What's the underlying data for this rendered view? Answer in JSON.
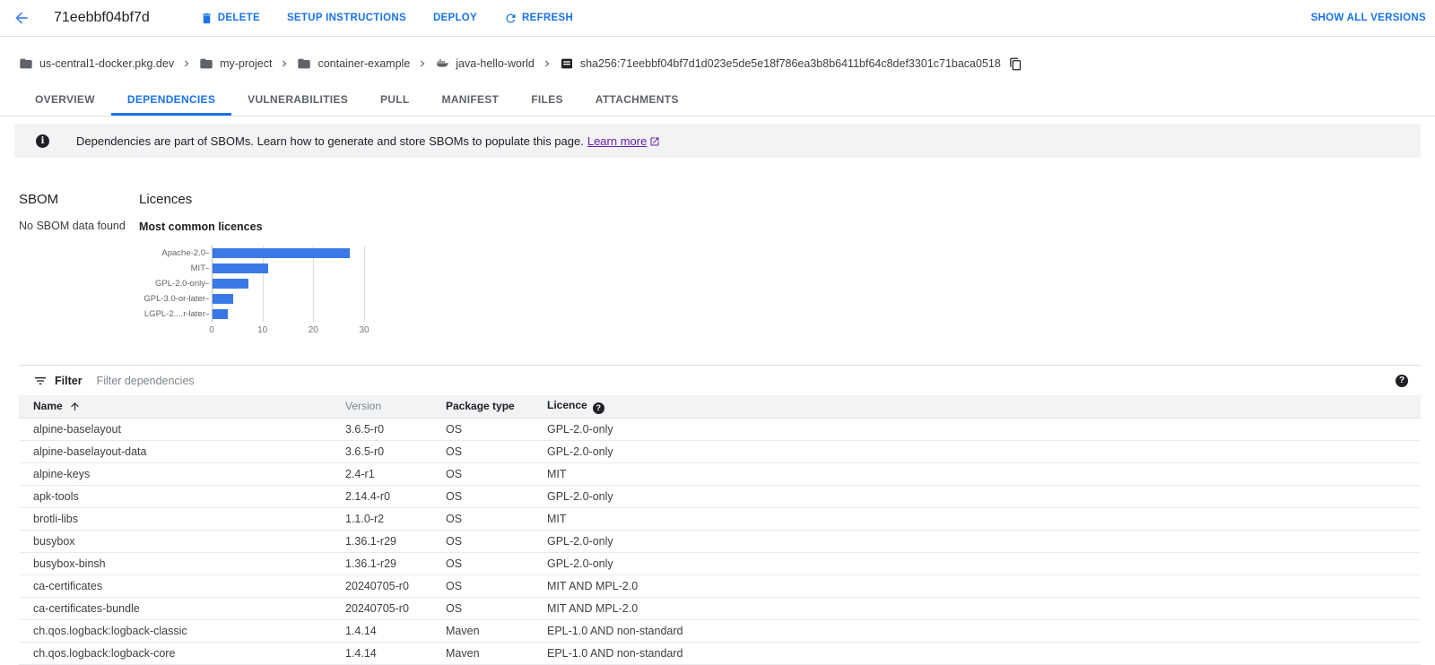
{
  "colors": {
    "accent_blue": "#1a73e8",
    "bar_blue": "#3b78e7",
    "link_purple": "#681da8",
    "banner_bg": "#f1f3f4",
    "header_row_bg": "#f1f3f4",
    "border": "#e0e0e0"
  },
  "topbar": {
    "back_icon": "arrow-back-icon",
    "title": "71eebbf04bf7d",
    "actions": [
      {
        "label": "DELETE",
        "icon": "trash"
      },
      {
        "label": "SETUP INSTRUCTIONS",
        "icon": null
      },
      {
        "label": "DEPLOY",
        "icon": null
      },
      {
        "label": "REFRESH",
        "icon": "refresh"
      }
    ],
    "show_all_versions_label": "SHOW ALL VERSIONS"
  },
  "breadcrumb": {
    "items": [
      {
        "label": "us-central1-docker.pkg.dev",
        "icon": "folder"
      },
      {
        "label": "my-project",
        "icon": "folder"
      },
      {
        "label": "container-example",
        "icon": "folder"
      },
      {
        "label": "java-hello-world",
        "icon": "docker"
      },
      {
        "label": "sha256:71eebbf04bf7d1d023e5de5e18f786ea3b8b6411bf64c8def3301c71baca0518",
        "icon": "image"
      }
    ],
    "copy_icon": "copy-icon"
  },
  "tabs": {
    "items": [
      "OVERVIEW",
      "DEPENDENCIES",
      "VULNERABILITIES",
      "PULL",
      "MANIFEST",
      "FILES",
      "ATTACHMENTS"
    ],
    "active": "DEPENDENCIES"
  },
  "banner": {
    "icon": "info-icon",
    "text": "Dependencies are part of SBOMs. Learn how to generate and store SBOMs to populate this page.",
    "link_label": "Learn more",
    "link_icon": "external-link-icon"
  },
  "sbom": {
    "title": "SBOM",
    "empty_text": "No SBOM data found"
  },
  "licences": {
    "title": "Licences"
  },
  "chart_data": {
    "type": "bar",
    "orientation": "horizontal",
    "title": "Most common licences",
    "categories": [
      "Apache-2.0",
      "MIT",
      "GPL-2.0-only",
      "GPL-3.0-or-later",
      "LGPL-2....r-later"
    ],
    "values": [
      27,
      11,
      7,
      4,
      3
    ],
    "xlim": [
      0,
      30
    ],
    "xticks": [
      0,
      10,
      20,
      30
    ],
    "bar_color": "#3b78e7",
    "grid": true,
    "legend": "none"
  },
  "filter": {
    "icon": "filter-list-icon",
    "label": "Filter",
    "placeholder": "Filter dependencies",
    "help_icon": "help-icon"
  },
  "table": {
    "columns": [
      "Name",
      "Version",
      "Package type",
      "Licence"
    ],
    "sort": {
      "column": "Name",
      "direction": "asc"
    },
    "licence_help_icon": "help-icon",
    "rows": [
      {
        "name": "alpine-baselayout",
        "version": "3.6.5-r0",
        "package_type": "OS",
        "licence": "GPL-2.0-only"
      },
      {
        "name": "alpine-baselayout-data",
        "version": "3.6.5-r0",
        "package_type": "OS",
        "licence": "GPL-2.0-only"
      },
      {
        "name": "alpine-keys",
        "version": "2.4-r1",
        "package_type": "OS",
        "licence": "MIT"
      },
      {
        "name": "apk-tools",
        "version": "2.14.4-r0",
        "package_type": "OS",
        "licence": "GPL-2.0-only"
      },
      {
        "name": "brotli-libs",
        "version": "1.1.0-r2",
        "package_type": "OS",
        "licence": "MIT"
      },
      {
        "name": "busybox",
        "version": "1.36.1-r29",
        "package_type": "OS",
        "licence": "GPL-2.0-only"
      },
      {
        "name": "busybox-binsh",
        "version": "1.36.1-r29",
        "package_type": "OS",
        "licence": "GPL-2.0-only"
      },
      {
        "name": "ca-certificates",
        "version": "20240705-r0",
        "package_type": "OS",
        "licence": "MIT AND MPL-2.0"
      },
      {
        "name": "ca-certificates-bundle",
        "version": "20240705-r0",
        "package_type": "OS",
        "licence": "MIT AND MPL-2.0"
      },
      {
        "name": "ch.qos.logback:logback-classic",
        "version": "1.4.14",
        "package_type": "Maven",
        "licence": "EPL-1.0 AND non-standard"
      },
      {
        "name": "ch.qos.logback:logback-core",
        "version": "1.4.14",
        "package_type": "Maven",
        "licence": "EPL-1.0 AND non-standard"
      }
    ]
  }
}
